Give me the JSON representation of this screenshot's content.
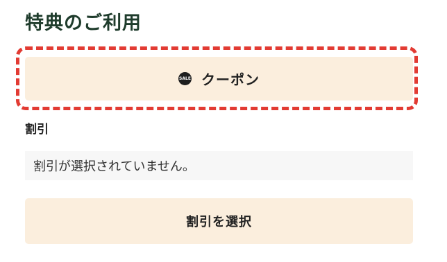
{
  "page": {
    "title": "特典のご利用"
  },
  "coupon": {
    "icon": "sale-badge-icon",
    "icon_text": "SALE",
    "label": "クーポン",
    "highlight_color": "#e23b33",
    "button_color": "#fbeedd"
  },
  "discount": {
    "heading": "割引",
    "status": "割引が選択されていません。",
    "select_button_label": "割引を選択"
  }
}
